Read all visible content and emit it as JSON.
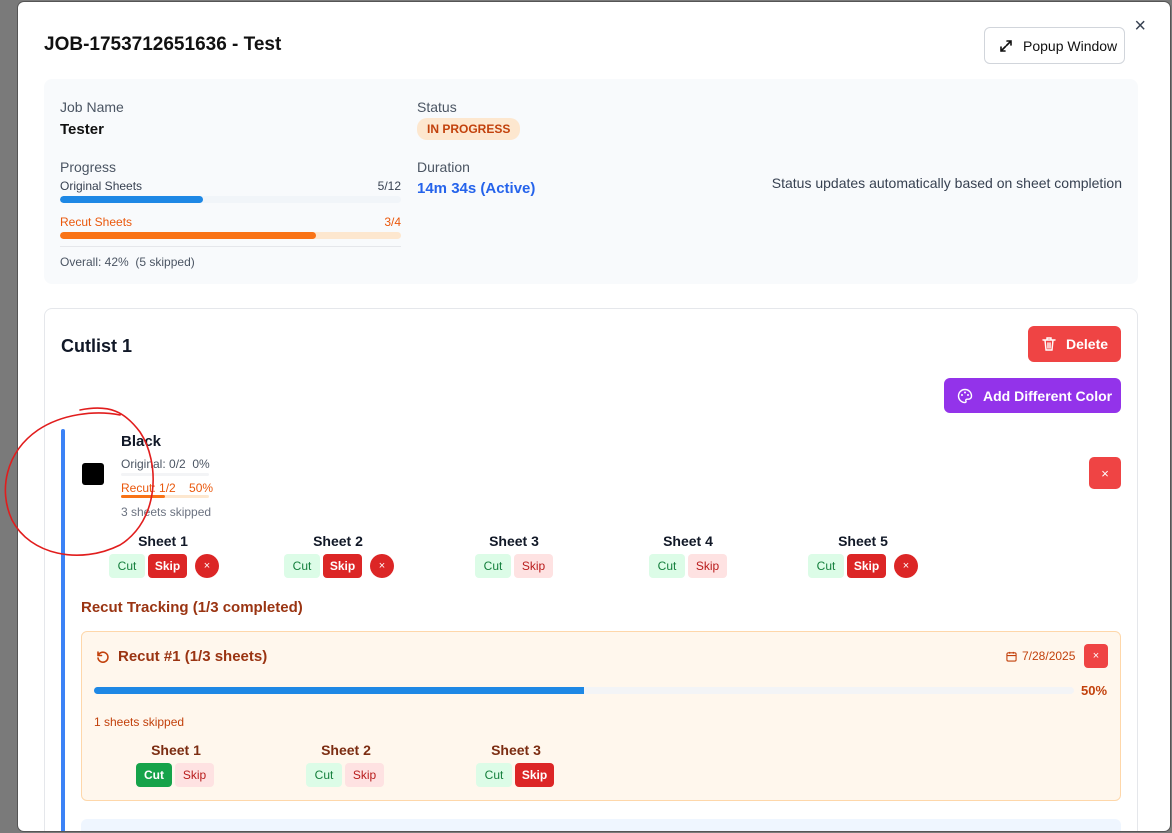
{
  "modal": {
    "title": "JOB-1753712651636 - Test",
    "close_icon": "×",
    "popup_button": "Popup Window"
  },
  "summary": {
    "job_name_label": "Job Name",
    "job_name": "Tester",
    "status_label": "Status",
    "status": "IN PROGRESS",
    "progress_label": "Progress",
    "original_label": "Original Sheets",
    "original_value": "5/12",
    "original_fraction": 0.42,
    "recut_label": "Recut Sheets",
    "recut_value": "3/4",
    "recut_fraction": 0.75,
    "overall": "Overall: 42%",
    "overall_skipped": "(5 skipped)",
    "duration_label": "Duration",
    "duration": "14m 34s (Active)",
    "note": "Status updates automatically based on sheet completion"
  },
  "cutlist": {
    "title": "Cutlist 1",
    "delete_button": "Delete",
    "add_color_button": "Add Different Color",
    "color": {
      "name": "Black",
      "swatch": "#000000",
      "original": "Original: 0/2",
      "original_pct": "0%",
      "original_fraction": 0,
      "recut": "Recut: 1/2",
      "recut_pct": "50%",
      "recut_fraction": 0.5,
      "skipped": "3 sheets skipped",
      "remove_icon": "×"
    },
    "sheets": [
      {
        "name": "Sheet 1",
        "cut": "Cut",
        "skip": "Skip",
        "cut_active": false,
        "skip_active": true,
        "remove": "×"
      },
      {
        "name": "Sheet 2",
        "cut": "Cut",
        "skip": "Skip",
        "cut_active": false,
        "skip_active": true,
        "remove": "×"
      },
      {
        "name": "Sheet 3",
        "cut": "Cut",
        "skip": "Skip",
        "cut_active": false,
        "skip_active": false
      },
      {
        "name": "Sheet 4",
        "cut": "Cut",
        "skip": "Skip",
        "cut_active": false,
        "skip_active": false
      },
      {
        "name": "Sheet 5",
        "cut": "Cut",
        "skip": "Skip",
        "cut_active": false,
        "skip_active": true,
        "remove": "×"
      }
    ],
    "recut_tracking_title": "Recut Tracking (1/3 completed)",
    "recut": {
      "title": "Recut #1 (1/3 sheets)",
      "date": "7/28/2025",
      "remove_icon": "×",
      "progress_fraction": 0.5,
      "progress_pct": "50%",
      "skipped": "1 sheets skipped",
      "sheets": [
        {
          "name": "Sheet 1",
          "cut": "Cut",
          "skip": "Skip",
          "cut_active": true,
          "skip_active": false
        },
        {
          "name": "Sheet 2",
          "cut": "Cut",
          "skip": "Skip",
          "cut_active": false,
          "skip_active": false
        },
        {
          "name": "Sheet 3",
          "cut": "Cut",
          "skip": "Skip",
          "cut_active": false,
          "skip_active": true
        }
      ]
    }
  },
  "colors": {
    "blue": "#1e88e5",
    "orange": "#f97316",
    "red": "#dc2626",
    "green": "#16a34a",
    "purple": "#9333ea",
    "annotation": "#e11d1d"
  },
  "icons": {
    "expand": "expand-icon",
    "trash": "trash-icon",
    "palette": "palette-icon",
    "refresh": "refresh-icon",
    "calendar": "calendar-icon"
  }
}
